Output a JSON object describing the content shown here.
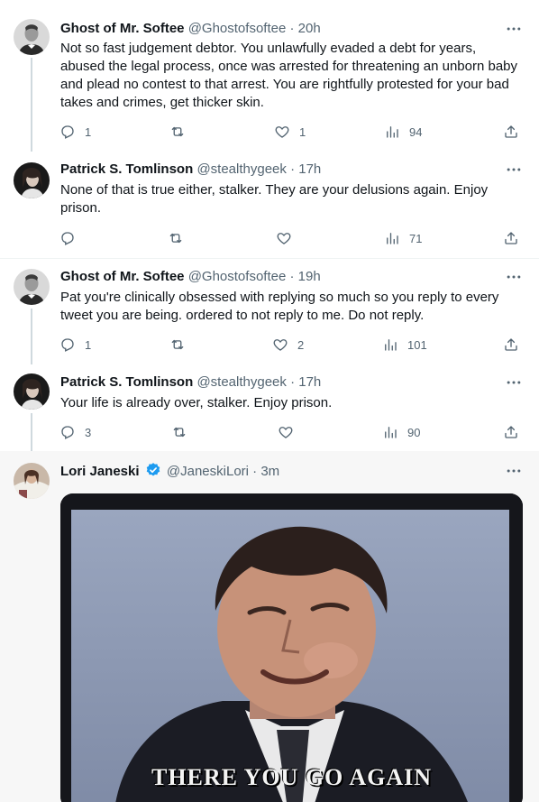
{
  "tweets": [
    {
      "name": "Ghost of Mr. Softee",
      "handle": "@Ghostofsoftee",
      "time": "· 20h",
      "text": "Not so fast judgement debtor. You unlawfully evaded a debt for years, abused the legal process, once was arrested for threatening an unborn baby and plead no contest to that arrest. You are rightfully protested for your bad takes and crimes, get thicker skin.",
      "replies": "1",
      "retweets": "",
      "likes": "1",
      "views": "94"
    },
    {
      "name": "Patrick S. Tomlinson",
      "handle": "@stealthygeek",
      "time": "· 17h",
      "text": "None of that is true either, stalker. They are your delusions again. Enjoy prison.",
      "replies": "",
      "retweets": "",
      "likes": "",
      "views": "71"
    },
    {
      "name": "Ghost of Mr. Softee",
      "handle": "@Ghostofsoftee",
      "time": "· 19h",
      "text": "Pat you're clinically obsessed with replying so much so you reply to every tweet you are being. ordered to not reply to me. Do not reply.",
      "replies": "1",
      "retweets": "",
      "likes": "2",
      "views": "101"
    },
    {
      "name": "Patrick S. Tomlinson",
      "handle": "@stealthygeek",
      "time": "· 17h",
      "text": "Your life is already over, stalker. Enjoy prison.",
      "replies": "3",
      "retweets": "",
      "likes": "",
      "views": "90"
    },
    {
      "name": "Lori Janeski",
      "handle": "@JaneskiLori",
      "time": "· 3m",
      "media_caption": "THERE YOU GO AGAIN"
    }
  ],
  "icons": {
    "more": "more-icon",
    "reply": "reply-icon",
    "retweet": "retweet-icon",
    "like": "like-icon",
    "views": "views-icon",
    "share": "share-icon",
    "verified": "verified-badge-icon"
  },
  "colors": {
    "text": "#0f1419",
    "secondary": "#536471",
    "verified": "#1d9bf0",
    "highlight_bg": "#f7f7f7"
  }
}
